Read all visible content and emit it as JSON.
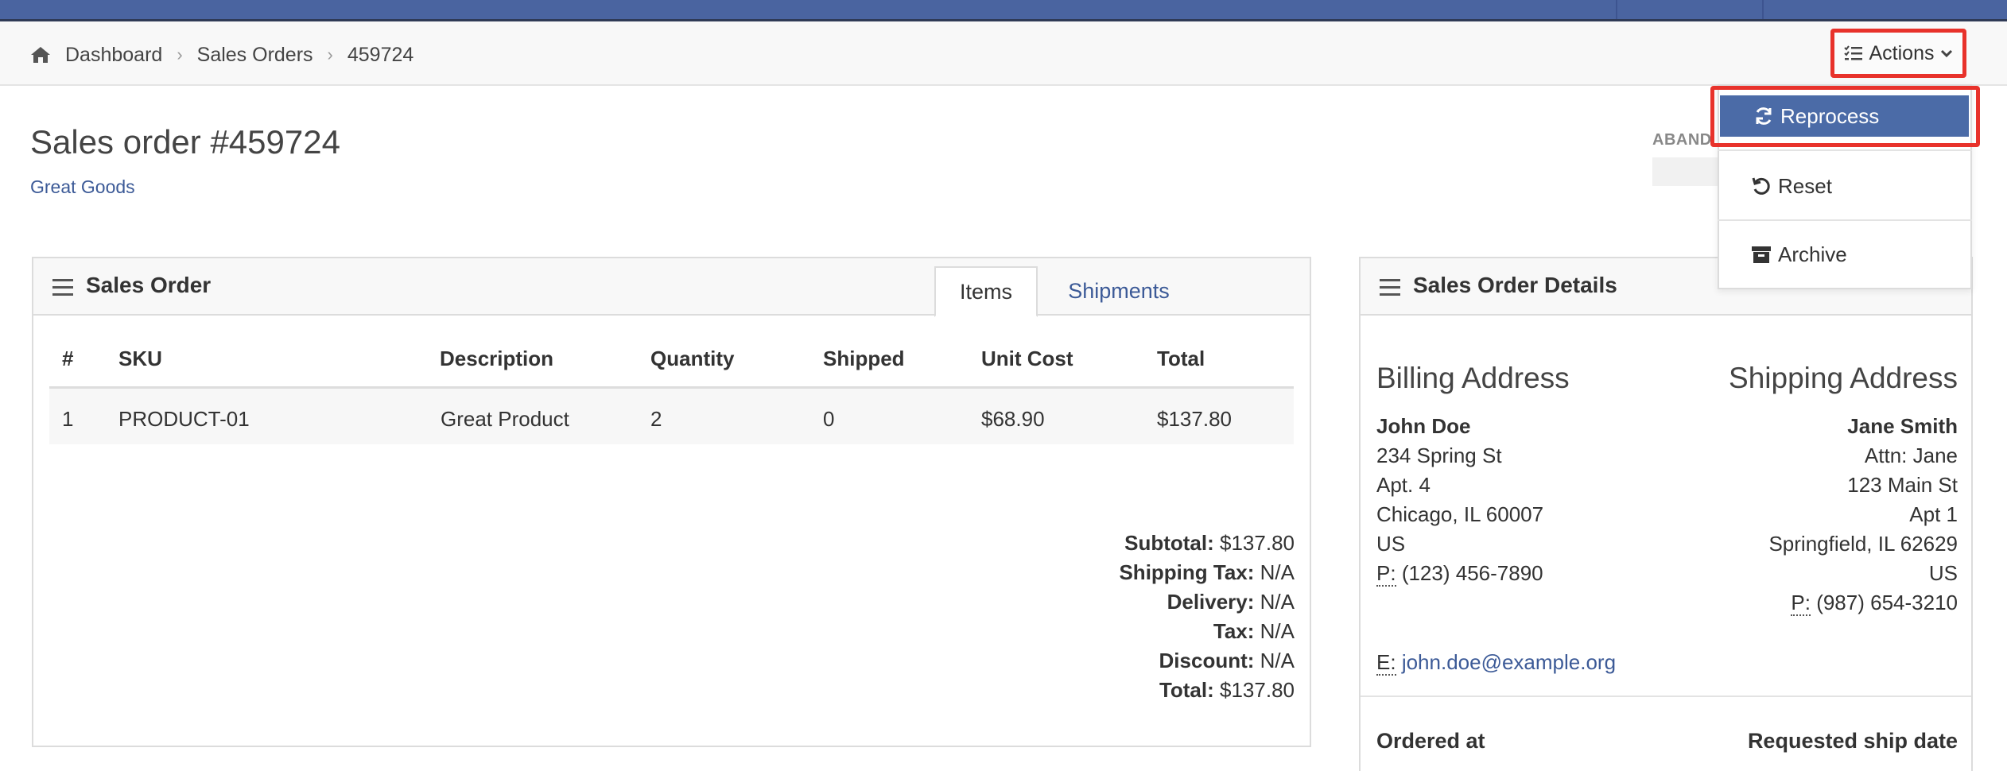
{
  "breadcrumb": {
    "items": [
      "Dashboard",
      "Sales Orders",
      "459724"
    ]
  },
  "actions": {
    "label": "Actions",
    "menu": [
      "Reprocess",
      "Reset",
      "Archive"
    ]
  },
  "page": {
    "title": "Sales order #459724",
    "company": "Great Goods",
    "status_label": "ABAND"
  },
  "sales_order_panel": {
    "title": "Sales Order",
    "tabs": [
      "Items",
      "Shipments"
    ],
    "columns": [
      "#",
      "SKU",
      "Description",
      "Quantity",
      "Shipped",
      "Unit Cost",
      "Total"
    ],
    "rows": [
      [
        "1",
        "PRODUCT-01",
        "Great Product",
        "2",
        "0",
        "$68.90",
        "$137.80"
      ]
    ],
    "totals": [
      {
        "label": "Subtotal:",
        "value": "$137.80"
      },
      {
        "label": "Shipping Tax:",
        "value": "N/A"
      },
      {
        "label": "Delivery:",
        "value": "N/A"
      },
      {
        "label": "Tax:",
        "value": "N/A"
      },
      {
        "label": "Discount:",
        "value": "N/A"
      },
      {
        "label": "Total:",
        "value": "$137.80"
      }
    ]
  },
  "details_panel": {
    "title": "Sales Order Details",
    "billing": {
      "title": "Billing Address",
      "name": "John Doe",
      "line1": "234 Spring St",
      "line2": "Apt. 4",
      "city": "Chicago, IL 60007",
      "country": "US",
      "phone_label": "P:",
      "phone": "(123) 456-7890",
      "email_label": "E:",
      "email": "john.doe@example.org"
    },
    "shipping": {
      "title": "Shipping Address",
      "name": "Jane Smith",
      "attn": "Attn: Jane",
      "line1": "123 Main St",
      "line2": "Apt 1",
      "city": "Springfield, IL 62629",
      "country": "US",
      "phone_label": "P:",
      "phone": "(987) 654-3210"
    },
    "ordered_at_label": "Ordered at",
    "requested_ship_label": "Requested ship date"
  },
  "colors": {
    "topbar": "#4a64a0",
    "accent": "#4b6ba7",
    "link": "#3c5a97",
    "highlight": "#e8322b"
  }
}
